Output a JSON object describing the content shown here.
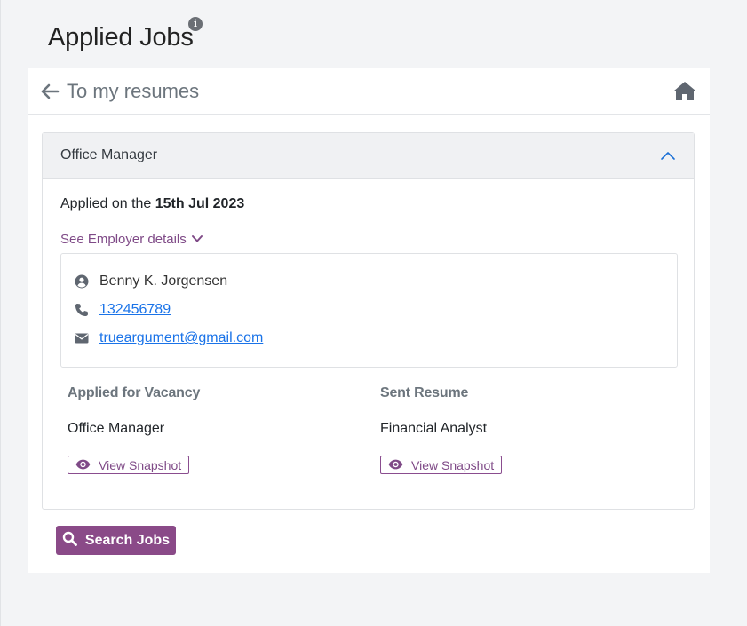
{
  "page": {
    "title": "Applied Jobs",
    "info_glyph": "i"
  },
  "nav": {
    "back_label": "To my resumes",
    "back_icon": "arrow-left-icon",
    "home_icon": "home-icon"
  },
  "application": {
    "job_title": "Office Manager",
    "applied_prefix": "Applied on the ",
    "applied_date": "15th Jul 2023",
    "employer_toggle_label": "See Employer details",
    "employer": {
      "name": "Benny K. Jorgensen",
      "phone": "132456789",
      "email": "trueargument@gmail.com"
    },
    "vacancy": {
      "heading": "Applied for Vacancy",
      "value": "Office Manager",
      "snapshot_label": "View Snapshot"
    },
    "resume": {
      "heading": "Sent Resume",
      "value": "Financial Analyst",
      "snapshot_label": "View Snapshot"
    }
  },
  "actions": {
    "search_jobs_label": "Search Jobs"
  },
  "colors": {
    "accent": "#8a4a88",
    "link": "#1a73e8",
    "background": "#f3f4f6",
    "muted_text": "#6c757d",
    "header_bg": "#f0f1f3"
  }
}
